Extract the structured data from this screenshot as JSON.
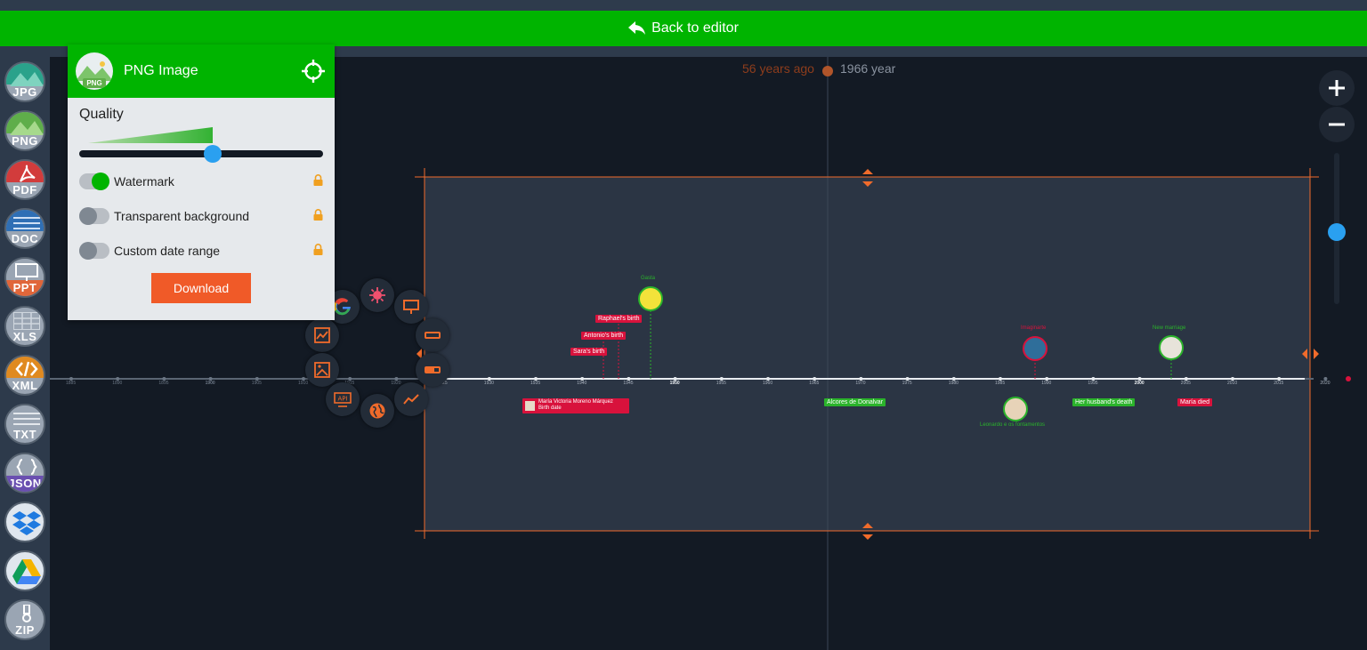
{
  "backbar": {
    "label": "Back to editor"
  },
  "sidebar": {
    "formats": [
      {
        "label": "JPG",
        "color": "#2aa28b"
      },
      {
        "label": "PNG",
        "color": "#5fae4a"
      },
      {
        "label": "PDF",
        "color": "#d23c3c"
      },
      {
        "label": "DOC",
        "color": "#2f6fb5"
      },
      {
        "label": "PPT",
        "color": "#e0663a"
      },
      {
        "label": "XLS",
        "color": "#3a8f52"
      },
      {
        "label": "XML",
        "color": "#e08a20"
      },
      {
        "label": "TXT",
        "color": "#7f8b98"
      },
      {
        "label": "JSON",
        "color": "#6a4fb0"
      },
      {
        "label": "",
        "color": "#1f7ae0"
      },
      {
        "label": "",
        "color": "#f4b400"
      },
      {
        "label": "ZIP",
        "color": "#7f8b98"
      }
    ]
  },
  "panel": {
    "title": "PNG Image",
    "icon_label": "PNG",
    "quality_label": "Quality",
    "quality_level": 0.55,
    "watermark_label": "Watermark",
    "transparent_label": "Transparent background",
    "custom_range_label": "Custom date range",
    "download_label": "Download"
  },
  "timeline": {
    "age_label": "56 years ago",
    "year_label": "1966 year",
    "ticks": [
      "1885",
      "1890",
      "1895",
      "1900",
      "1905",
      "1910",
      "1915",
      "1920",
      "1925",
      "1930",
      "1935",
      "1940",
      "1945",
      "1950",
      "1955",
      "1960",
      "1965",
      "1970",
      "1975",
      "1980",
      "1985",
      "1990",
      "1995",
      "2000",
      "2005",
      "2010",
      "2015",
      "2020"
    ],
    "events_above": [
      {
        "label": "Raphael's birth"
      },
      {
        "label": "Antonio's birth"
      },
      {
        "label": "Sara's birth"
      }
    ],
    "photo_events": [
      {
        "label": "Gasta"
      },
      {
        "label": "Imaginarte"
      },
      {
        "label": "New marriage"
      }
    ],
    "events_below": [
      {
        "label": "María Victoria Moreno Márquez"
      },
      {
        "label": "Birth date"
      },
      {
        "label": "Alcores de Donalvar"
      },
      {
        "label": "Leonardo e os fontamentos"
      },
      {
        "label": "Her husband's death"
      },
      {
        "label": "María died"
      }
    ]
  },
  "colors": {
    "accent_green": "#00b400",
    "accent_orange": "#f05a28",
    "zoom_blue": "#2aa0f0",
    "event_red": "#d8123c"
  }
}
